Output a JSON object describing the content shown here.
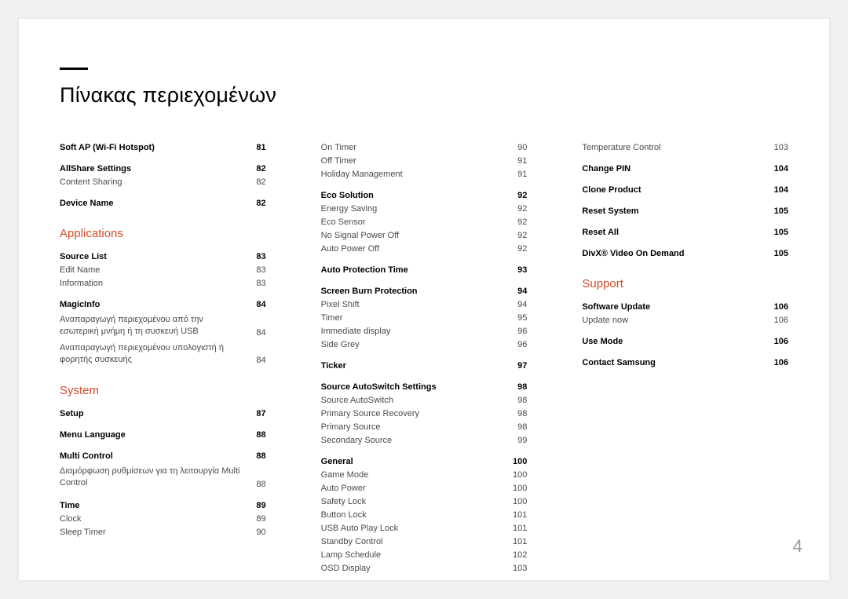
{
  "title": "Πίνακας περιεχομένων",
  "page_number": "4",
  "col1": {
    "pre": [
      {
        "items": [
          {
            "t": "Soft AP (Wi-Fi Hotspot)",
            "p": "81",
            "b": true
          }
        ]
      },
      {
        "items": [
          {
            "t": "AllShare Settings",
            "p": "82",
            "b": true
          },
          {
            "t": "Content Sharing",
            "p": "82",
            "b": false
          }
        ]
      },
      {
        "items": [
          {
            "t": "Device Name",
            "p": "82",
            "b": true
          }
        ]
      }
    ],
    "sections": [
      {
        "heading": "Applications",
        "groups": [
          {
            "items": [
              {
                "t": "Source List",
                "p": "83",
                "b": true
              },
              {
                "t": "Edit Name",
                "p": "83",
                "b": false
              },
              {
                "t": "Information",
                "p": "83",
                "b": false
              }
            ]
          },
          {
            "items": [
              {
                "t": "MagicInfo",
                "p": "84",
                "b": true
              },
              {
                "t": "Αναπαραγωγή περιεχομένου από την εσωτερική μνήμη ή τη συσκευή USB",
                "p": "84",
                "b": false,
                "wrap": true
              },
              {
                "t": "Αναπαραγωγή περιεχομένου υπολογιστή ή φορητής συσκευής",
                "p": "84",
                "b": false,
                "wrap": true
              }
            ]
          }
        ]
      },
      {
        "heading": "System",
        "groups": [
          {
            "items": [
              {
                "t": "Setup",
                "p": "87",
                "b": true
              }
            ]
          },
          {
            "items": [
              {
                "t": "Menu Language",
                "p": "88",
                "b": true
              }
            ]
          },
          {
            "items": [
              {
                "t": "Multi Control",
                "p": "88",
                "b": true
              },
              {
                "t": "Διαμόρφωση ρυθμίσεων για τη λειτουργία Multi Control",
                "p": "88",
                "b": false,
                "wrap": true
              }
            ]
          },
          {
            "items": [
              {
                "t": "Time",
                "p": "89",
                "b": true
              },
              {
                "t": "Clock",
                "p": "89",
                "b": false
              },
              {
                "t": "Sleep Timer",
                "p": "90",
                "b": false
              }
            ]
          }
        ]
      }
    ]
  },
  "col2": {
    "pre": [
      {
        "items": [
          {
            "t": "On Timer",
            "p": "90",
            "b": false
          },
          {
            "t": "Off Timer",
            "p": "91",
            "b": false
          },
          {
            "t": "Holiday Management",
            "p": "91",
            "b": false
          }
        ]
      },
      {
        "items": [
          {
            "t": "Eco Solution",
            "p": "92",
            "b": true
          },
          {
            "t": "Energy Saving",
            "p": "92",
            "b": false
          },
          {
            "t": "Eco Sensor",
            "p": "92",
            "b": false
          },
          {
            "t": "No Signal Power Off",
            "p": "92",
            "b": false
          },
          {
            "t": "Auto Power Off",
            "p": "92",
            "b": false
          }
        ]
      },
      {
        "items": [
          {
            "t": "Auto Protection Time",
            "p": "93",
            "b": true
          }
        ]
      },
      {
        "items": [
          {
            "t": "Screen Burn Protection",
            "p": "94",
            "b": true
          },
          {
            "t": "Pixel Shift",
            "p": "94",
            "b": false
          },
          {
            "t": "Timer",
            "p": "95",
            "b": false
          },
          {
            "t": "Immediate display",
            "p": "96",
            "b": false
          },
          {
            "t": "Side Grey",
            "p": "96",
            "b": false
          }
        ]
      },
      {
        "items": [
          {
            "t": "Ticker",
            "p": "97",
            "b": true
          }
        ]
      },
      {
        "items": [
          {
            "t": "Source AutoSwitch Settings",
            "p": "98",
            "b": true
          },
          {
            "t": "Source AutoSwitch",
            "p": "98",
            "b": false
          },
          {
            "t": "Primary Source Recovery",
            "p": "98",
            "b": false
          },
          {
            "t": "Primary Source",
            "p": "98",
            "b": false
          },
          {
            "t": "Secondary Source",
            "p": "99",
            "b": false
          }
        ]
      },
      {
        "items": [
          {
            "t": "General",
            "p": "100",
            "b": true
          },
          {
            "t": "Game Mode",
            "p": "100",
            "b": false
          },
          {
            "t": "Auto Power",
            "p": "100",
            "b": false
          },
          {
            "t": "Safety Lock",
            "p": "100",
            "b": false
          },
          {
            "t": "Button Lock",
            "p": "101",
            "b": false
          },
          {
            "t": "USB Auto Play Lock",
            "p": "101",
            "b": false
          },
          {
            "t": "Standby Control",
            "p": "101",
            "b": false
          },
          {
            "t": "Lamp Schedule",
            "p": "102",
            "b": false
          },
          {
            "t": "OSD Display",
            "p": "103",
            "b": false
          }
        ]
      }
    ],
    "sections": []
  },
  "col3": {
    "pre": [
      {
        "items": [
          {
            "t": "Temperature Control",
            "p": "103",
            "b": false
          }
        ]
      },
      {
        "items": [
          {
            "t": "Change PIN",
            "p": "104",
            "b": true
          }
        ]
      },
      {
        "items": [
          {
            "t": "Clone Product",
            "p": "104",
            "b": true
          }
        ]
      },
      {
        "items": [
          {
            "t": "Reset System",
            "p": "105",
            "b": true
          }
        ]
      },
      {
        "items": [
          {
            "t": "Reset All",
            "p": "105",
            "b": true
          }
        ]
      },
      {
        "items": [
          {
            "t": "DivX® Video On Demand",
            "p": "105",
            "b": true
          }
        ]
      }
    ],
    "sections": [
      {
        "heading": "Support",
        "groups": [
          {
            "items": [
              {
                "t": "Software Update",
                "p": "106",
                "b": true
              },
              {
                "t": "Update now",
                "p": "106",
                "b": false
              }
            ]
          },
          {
            "items": [
              {
                "t": "Use Mode",
                "p": "106",
                "b": true
              }
            ]
          },
          {
            "items": [
              {
                "t": "Contact Samsung",
                "p": "106",
                "b": true
              }
            ]
          }
        ]
      }
    ]
  }
}
